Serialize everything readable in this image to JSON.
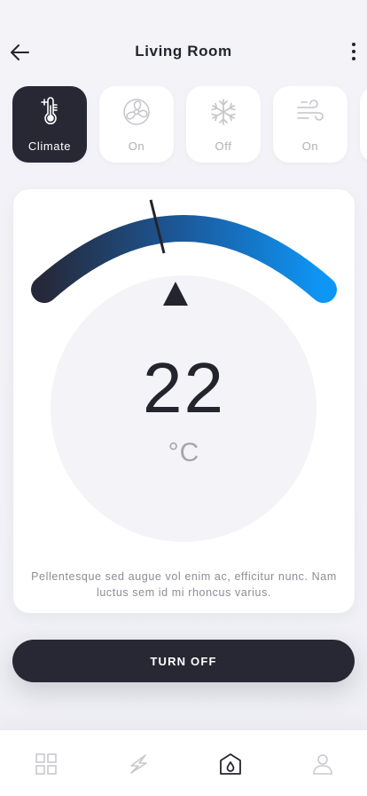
{
  "header": {
    "title": "Living Room"
  },
  "modes": [
    {
      "label": "Climate",
      "icon": "thermometer-icon",
      "active": true
    },
    {
      "label": "On",
      "icon": "fan-icon",
      "active": false
    },
    {
      "label": "Off",
      "icon": "snowflake-icon",
      "active": false
    },
    {
      "label": "On",
      "icon": "wind-icon",
      "active": false
    }
  ],
  "thermostat": {
    "temperature": "22",
    "unit": "°C",
    "description": "Pellentesque sed augue vol enim ac, efficitur nunc. Nam luctus sem id mi rhoncus varius.",
    "gauge_colors": [
      "#26293a",
      "#1b5a9c",
      "#0e96f7"
    ]
  },
  "actions": {
    "turn_off_label": "TURN OFF"
  },
  "bottom_nav": [
    {
      "icon": "dashboard-grid-icon",
      "active": false
    },
    {
      "icon": "lightning-icon",
      "active": false
    },
    {
      "icon": "home-icon",
      "active": true
    },
    {
      "icon": "user-icon",
      "active": false
    }
  ],
  "colors": {
    "dark": "#272833",
    "background": "#f2f2f7",
    "muted": "#b0b0b8"
  }
}
